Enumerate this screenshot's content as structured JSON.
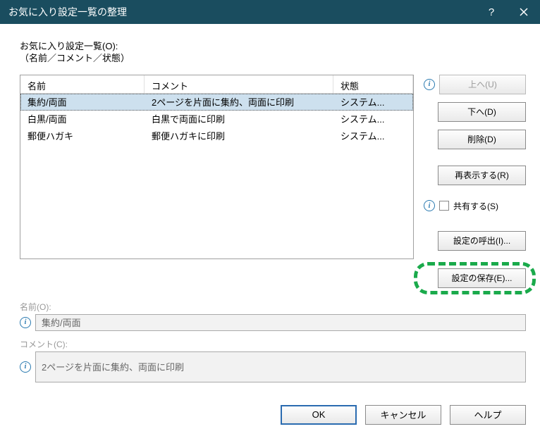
{
  "window": {
    "title": "お気に入り設定一覧の整理"
  },
  "list_label_line1": "お気に入り設定一覧(O):",
  "list_label_line2": "（名前／コメント／状態）",
  "headers": {
    "name": "名前",
    "comment": "コメント",
    "status": "状態"
  },
  "rows": [
    {
      "name": "集約/両面",
      "comment": "2ページを片面に集約、両面に印刷",
      "status": "システム...",
      "selected": true
    },
    {
      "name": "白黒/両面",
      "comment": "白黒で両面に印刷",
      "status": "システム...",
      "selected": false
    },
    {
      "name": "郵便ハガキ",
      "comment": "郵便ハガキに印刷",
      "status": "システム...",
      "selected": false
    }
  ],
  "side": {
    "up": "上へ(U)",
    "down": "下へ(D)",
    "delete": "削除(D)",
    "redisplay": "再表示する(R)",
    "share": "共有する(S)",
    "recall": "設定の呼出(I)...",
    "save": "設定の保存(E)..."
  },
  "name_field": {
    "label": "名前(O):",
    "value": "集約/両面"
  },
  "comment_field": {
    "label": "コメント(C):",
    "value": "2ページを片面に集約、両面に印刷"
  },
  "buttons": {
    "ok": "OK",
    "cancel": "キャンセル",
    "help": "ヘルプ"
  }
}
